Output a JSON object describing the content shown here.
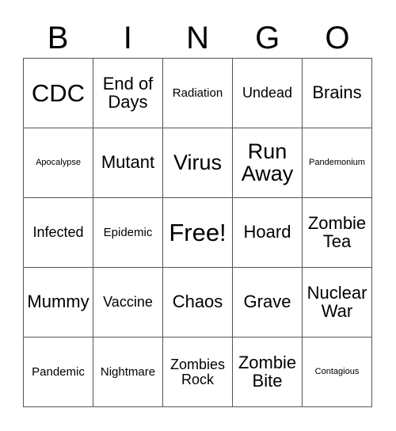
{
  "card": {
    "header_letters": [
      "B",
      "I",
      "N",
      "G",
      "O"
    ],
    "free_space_label": "Free!",
    "border_color": "#555555",
    "background_color": "#ffffff",
    "text_color": "#000000",
    "grid_size": "5x5"
  },
  "cells": [
    [
      {
        "text": "CDC",
        "size": "xl"
      },
      {
        "text": "End of\nDays",
        "size": "md"
      },
      {
        "text": "Radiation",
        "size": "xs"
      },
      {
        "text": "Undead",
        "size": "sm"
      },
      {
        "text": "Brains",
        "size": "md"
      }
    ],
    [
      {
        "text": "Apocalypse",
        "size": "xxs"
      },
      {
        "text": "Mutant",
        "size": "md"
      },
      {
        "text": "Virus",
        "size": "lg"
      },
      {
        "text": "Run\nAway",
        "size": "lg"
      },
      {
        "text": "Pandemonium",
        "size": "xxs"
      }
    ],
    [
      {
        "text": "Infected",
        "size": "sm"
      },
      {
        "text": "Epidemic",
        "size": "xs"
      },
      {
        "text": "Free!",
        "size": "xl"
      },
      {
        "text": "Hoard",
        "size": "md"
      },
      {
        "text": "Zombie\nTea",
        "size": "md"
      }
    ],
    [
      {
        "text": "Mummy",
        "size": "md"
      },
      {
        "text": "Vaccine",
        "size": "sm"
      },
      {
        "text": "Chaos",
        "size": "md"
      },
      {
        "text": "Grave",
        "size": "md"
      },
      {
        "text": "Nuclear\nWar",
        "size": "md"
      }
    ],
    [
      {
        "text": "Pandemic",
        "size": "xs"
      },
      {
        "text": "Nightmare",
        "size": "xs"
      },
      {
        "text": "Zombies\nRock",
        "size": "sm"
      },
      {
        "text": "Zombie\nBite",
        "size": "md"
      },
      {
        "text": "Contagious",
        "size": "xxs"
      }
    ]
  ]
}
